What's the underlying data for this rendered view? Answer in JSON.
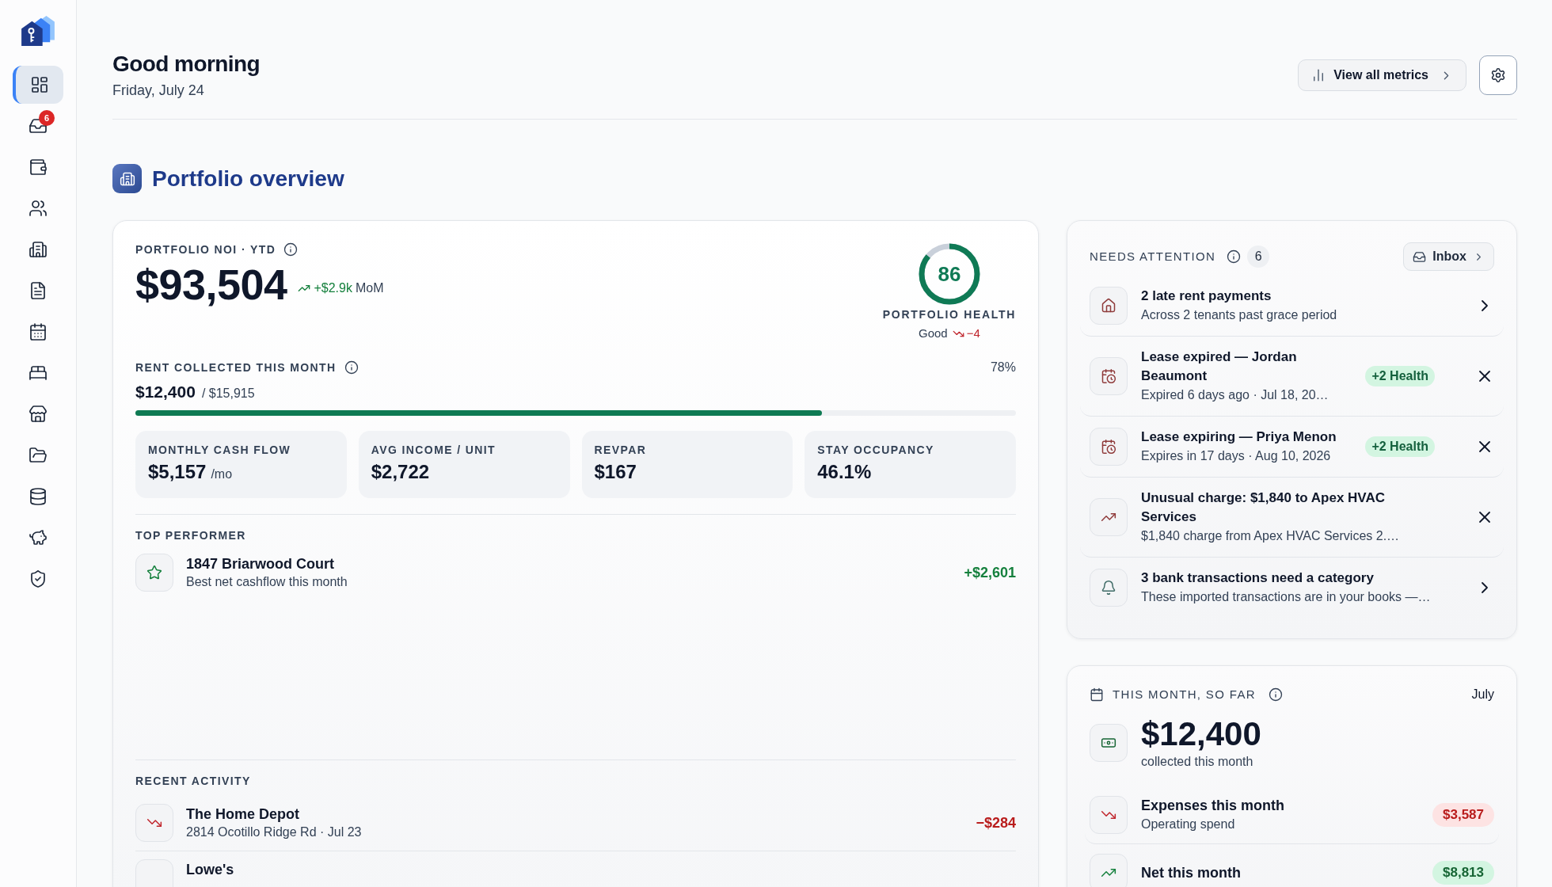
{
  "sidebar": {
    "items": [
      {
        "selected": true
      },
      {
        "selected": false,
        "badge": "6"
      },
      {
        "selected": false
      },
      {
        "selected": false
      },
      {
        "selected": false
      },
      {
        "selected": false
      },
      {
        "selected": false
      },
      {
        "selected": false
      },
      {
        "selected": false
      },
      {
        "selected": false
      },
      {
        "selected": false
      },
      {
        "selected": false
      },
      {
        "selected": false
      }
    ]
  },
  "header": {
    "title": "Good morning",
    "date": "Friday, July 24",
    "metrics_button": "View all metrics"
  },
  "section": {
    "title": "Portfolio overview"
  },
  "overview": {
    "noi": {
      "label": "PORTFOLIO NOI · YTD",
      "value": "$93,504",
      "change": "+$2.9k",
      "period": "MoM",
      "negative": false
    },
    "health": {
      "score": "86",
      "level": 0.86,
      "label": "PORTFOLIO HEALTH",
      "status": "Good",
      "change": "−4",
      "negative": true
    },
    "rent": {
      "label": "RENT COLLECTED THIS MONTH",
      "percent": "78%",
      "collected": "$12,400",
      "total": "/ $15,915",
      "level": 0.78
    },
    "metrics": [
      {
        "label": "MONTHLY CASH FLOW",
        "value": "$5,157",
        "unit": "/mo"
      },
      {
        "label": "AVG INCOME / UNIT",
        "value": "$2,722"
      },
      {
        "label": "REVPAR",
        "value": "$167"
      },
      {
        "label": "STAY OCCUPANCY",
        "value": "46.1%"
      }
    ],
    "top_performer": {
      "heading": "TOP PERFORMER",
      "title": "1847 Briarwood Court",
      "subtitle": "Best net cashflow this month",
      "amount": "+$2,601"
    },
    "recent_activity": {
      "heading": "RECENT ACTIVITY",
      "rows": [
        {
          "kind": "expense",
          "title": "The Home Depot",
          "subtitle": "2814 Ocotillo Ridge Rd · Jul 23",
          "amount": "−$284"
        },
        {
          "title": "Lowe's"
        }
      ]
    }
  },
  "needs_attention": {
    "title": "NEEDS ATTENTION",
    "count": "6",
    "inbox_button": "Inbox",
    "items": [
      {
        "kind": "rent",
        "dismissible": false,
        "title": "2 late rent payments",
        "subtitle": "Across 2 tenants past grace period"
      },
      {
        "kind": "lease",
        "dismissible": true,
        "title": "Lease expired — Jordan Beaumont",
        "subtitle": "Expired 6 days ago · Jul 18, 20…",
        "badge": "+2 Health"
      },
      {
        "kind": "lease",
        "dismissible": true,
        "title": "Lease expiring — Priya Menon",
        "subtitle": "Expires in 17 days · Aug 10, 2026",
        "badge": "+2 Health"
      },
      {
        "kind": "charge",
        "dismissible": true,
        "title": "Unusual charge: $1,840 to Apex HVAC Services",
        "subtitle": "$1,840 charge from Apex HVAC Services 2.…"
      },
      {
        "kind": "books",
        "dismissible": false,
        "title": "3 bank transactions need a category",
        "subtitle": "These imported transactions are in your books —…"
      }
    ]
  },
  "this_month": {
    "title": "THIS MONTH, SO FAR",
    "month": "July",
    "collected": "$12,400",
    "collected_label": "collected this month",
    "rows": [
      {
        "kind": "expense",
        "title": "Expenses this month",
        "subtitle": "Operating spend",
        "amount": "$3,587"
      },
      {
        "kind": "net",
        "title": "Net this month",
        "amount": "$8,813"
      }
    ]
  }
}
